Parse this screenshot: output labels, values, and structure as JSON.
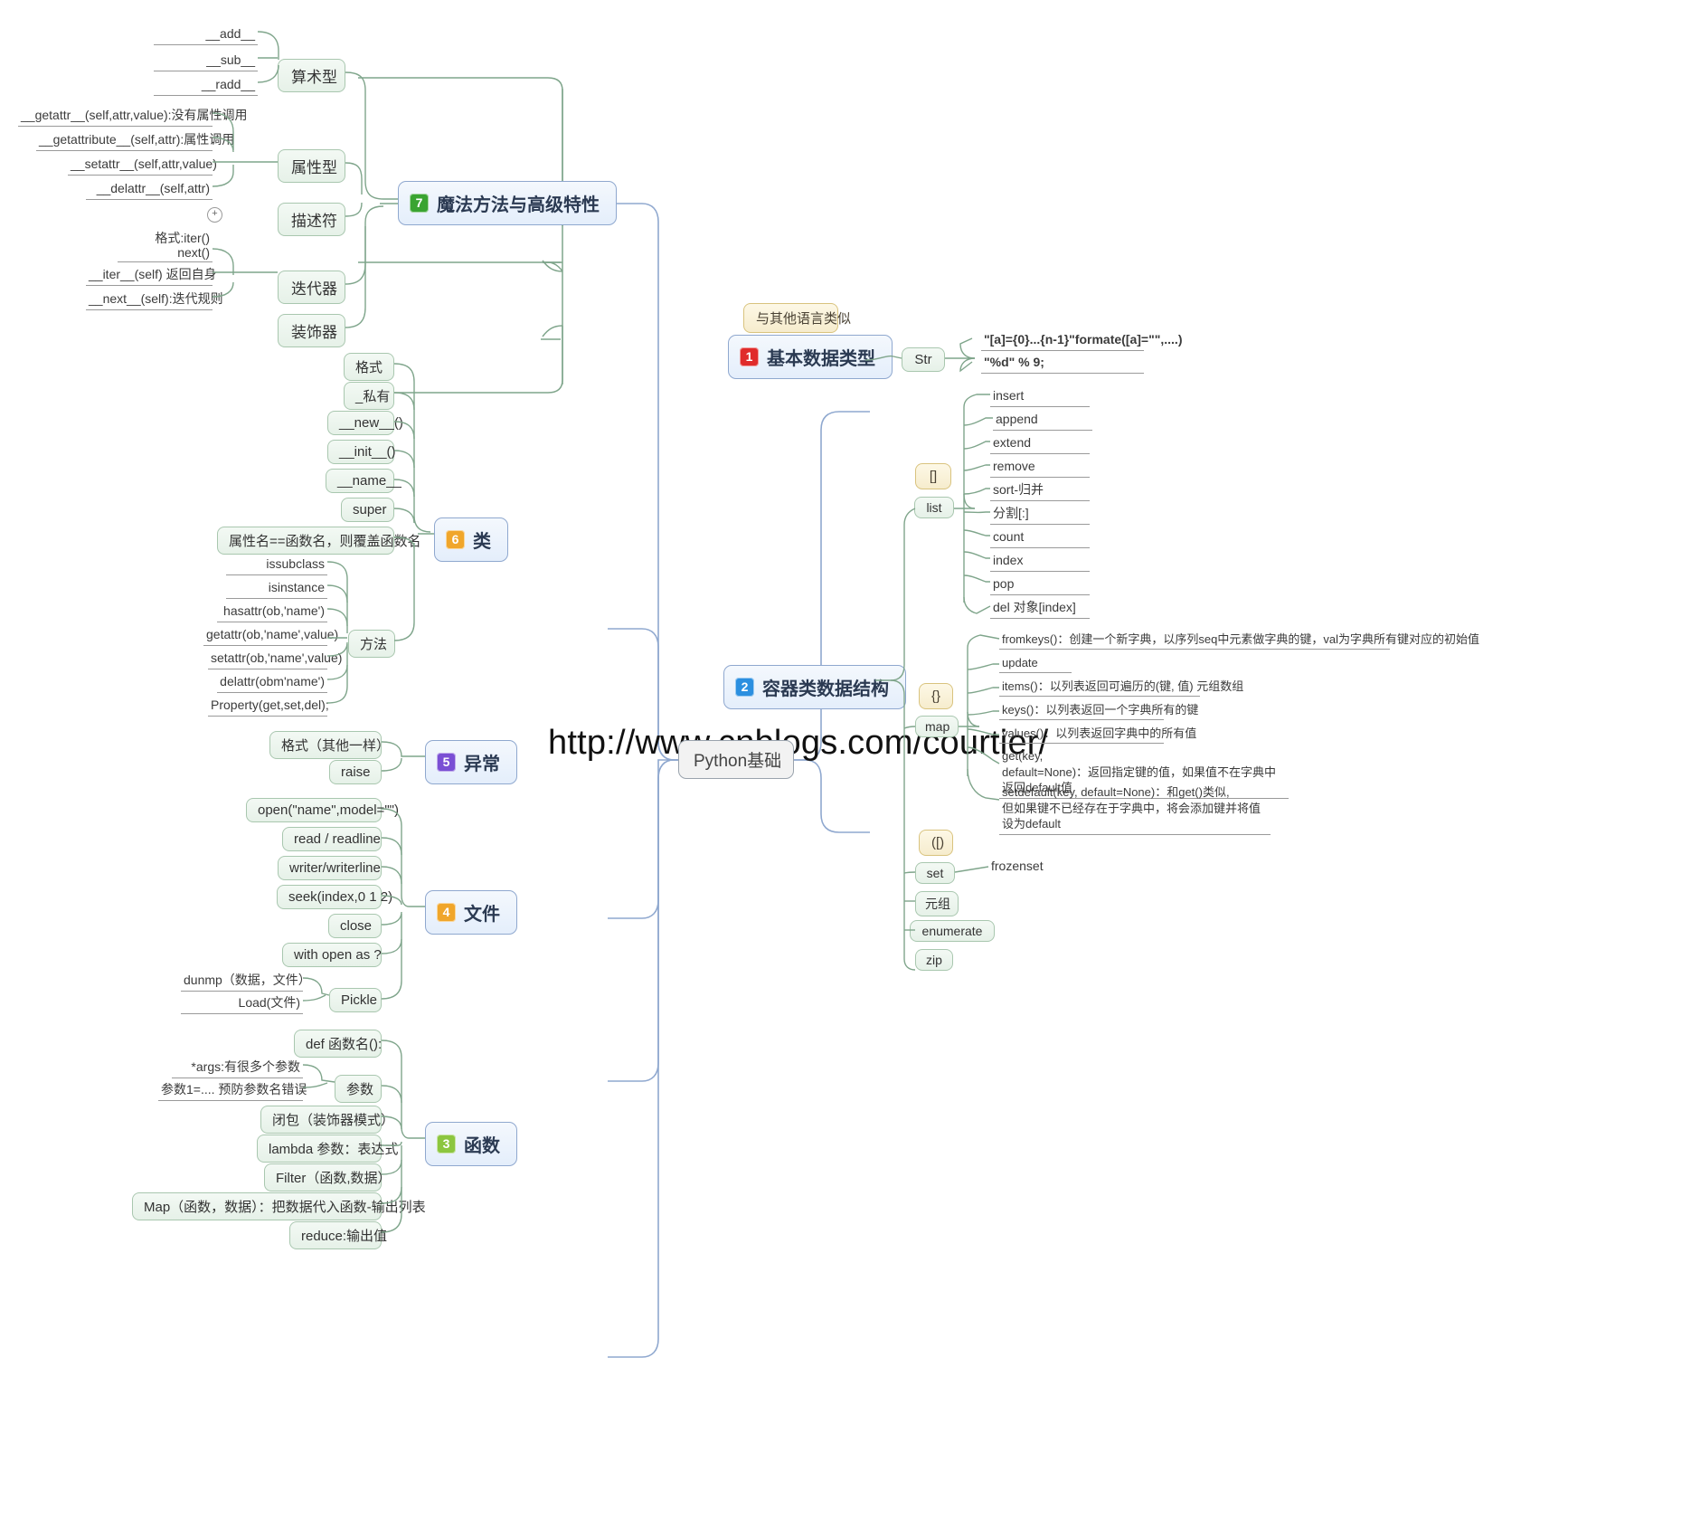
{
  "watermark": "http://www.cnblogs.com/courtier/",
  "root": {
    "label": "Python基础"
  },
  "branches": {
    "magic": {
      "label": "魔法方法与高级特性",
      "number": "7",
      "badge_color": "#3aa431",
      "groups": [
        {
          "label": "算术型",
          "leaves": [
            "__add__",
            "__sub__",
            "__radd__"
          ]
        },
        {
          "label": "属性型",
          "leaves": [
            "__getattr__(self,attr,value):没有属性调用",
            "__getattribute__(self,attr):属性调用",
            "__setattr__(self,attr,value)",
            "__delattr__(self,attr)"
          ]
        },
        {
          "label": "描述符",
          "leaves": [],
          "collapsed_icon": "plus-icon"
        },
        {
          "label": "迭代器",
          "leaves": [
            "格式:iter()\nnext()",
            "__iter__(self) 返回自身",
            "__next__(self):迭代规则"
          ]
        },
        {
          "label": "装饰器",
          "leaves": []
        }
      ]
    },
    "classes": {
      "label": "类",
      "number": "6",
      "badge_color": "#f0a62b",
      "items": [
        "格式",
        "_私有",
        "__new__()",
        "__init__()",
        "__name__",
        "super",
        "属性名==函数名，则覆盖函数名"
      ],
      "methods": {
        "label": "方法",
        "leaves": [
          "issubclass",
          "isinstance",
          "hasattr(ob,'name')",
          "getattr(ob,'name',value)",
          "setattr(ob,'name',value)",
          "delattr(obm'name')",
          "Property(get,set,del);"
        ]
      }
    },
    "exception": {
      "label": "异常",
      "number": "5",
      "badge_color": "#7a4fd4",
      "items": [
        "格式（其他一样）",
        "raise"
      ]
    },
    "file": {
      "label": "文件",
      "number": "4",
      "badge_color": "#f0a62b",
      "items": [
        "open(\"name\",model=\"\")",
        "read / readline",
        "writer/writerline",
        "seek(index,0 1 2)",
        "close",
        "with open as ?"
      ],
      "pickle": {
        "label": "Pickle",
        "leaves": [
          "dunmp（数据，文件）",
          "Load(文件)"
        ]
      }
    },
    "functions": {
      "label": "函数",
      "number": "3",
      "badge_color": "#8cc63f",
      "items": [
        "def 函数名():",
        "闭包（装饰器模式）",
        "lambda 参数：表达式",
        "Filter（函数,数据）",
        "Map（函数，数据）：把数据代入函数-输出列表",
        "reduce:输出值"
      ],
      "params": {
        "label": "参数",
        "leaves": [
          "*args:有很多个参数",
          "参数1=.... 预防参数名错误"
        ]
      }
    },
    "basic_types": {
      "label": "基本数据类型",
      "number": "1",
      "badge_color": "#e02b2b",
      "note": "与其他语言类似",
      "str": {
        "label": "Str",
        "leaves": [
          "\"[a]={0}...{n-1}\"formate([a]=\"\",....)",
          "\"%d\" % 9;"
        ]
      }
    },
    "containers": {
      "label": "容器类数据结构",
      "number": "2",
      "badge_color": "#2b8fe0",
      "list": {
        "label": "list",
        "note": "[]",
        "leaves": [
          "insert",
          "append",
          "extend",
          "remove",
          "sort-归并",
          "分割[:]",
          "count",
          "index",
          "pop",
          "del 对象[index]"
        ]
      },
      "map": {
        "label": "map",
        "note": "{}",
        "leaves": [
          "fromkeys()：创建一个新字典，以序列seq中元素做字典的键，val为字典所有键对应的初始值",
          "update",
          "items()：以列表返回可遍历的(键, 值) 元组数组",
          "keys()：以列表返回一个字典所有的键",
          "values()：以列表返回字典中的所有值",
          "get(key,\ndefault=None)：返回指定键的值，如果值不在字典中返回default值",
          "setdefault(key, default=None)：和get()类似,\n但如果键不已经存在于字典中，将会添加键并将值设为default"
        ]
      },
      "set": {
        "label": "set",
        "note": "([)",
        "leaves": [
          "frozenset"
        ]
      },
      "others": [
        "元组",
        "enumerate",
        "zip"
      ]
    }
  }
}
